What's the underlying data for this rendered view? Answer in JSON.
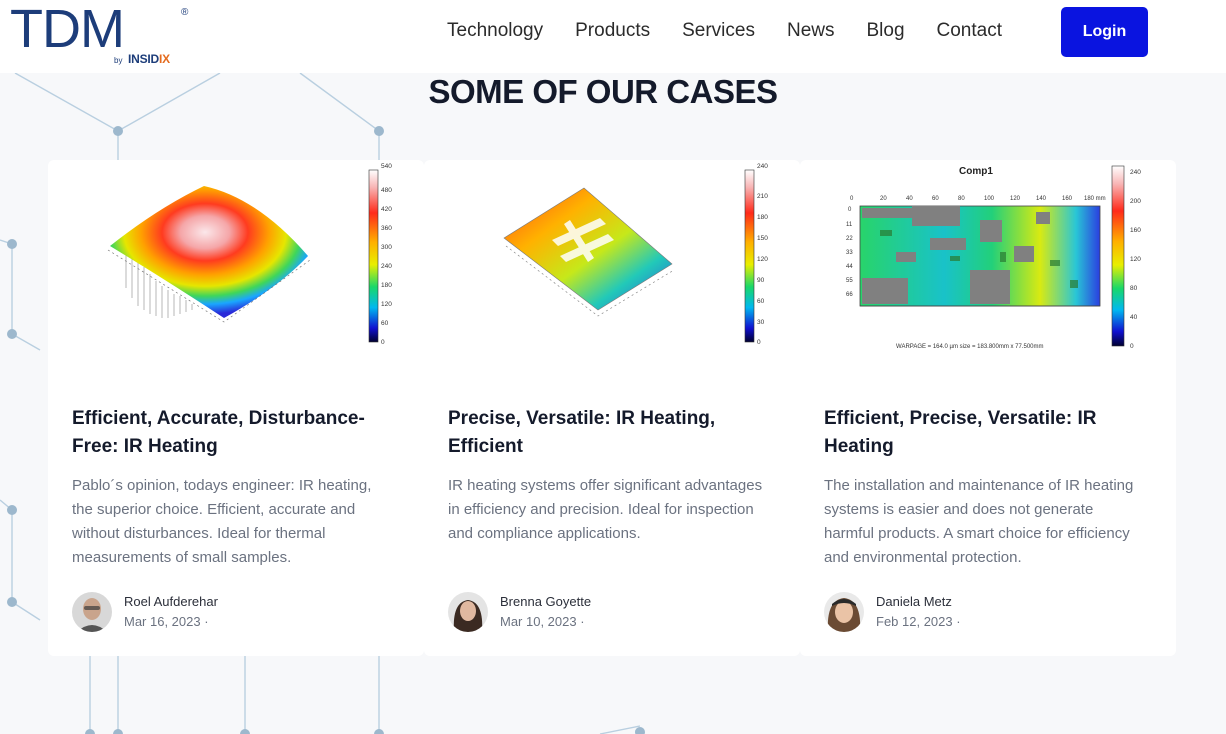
{
  "brand": {
    "logo_main": "TDM",
    "logo_reg": "®",
    "logo_by": "by",
    "logo_sub_a": "INSID",
    "logo_sub_b": "IX"
  },
  "nav": [
    "Technology",
    "Products",
    "Services",
    "News",
    "Blog",
    "Contact"
  ],
  "login_label": "Login",
  "section_title": "SOME OF OUR CASES",
  "cards": [
    {
      "title": "Efficient, Accurate, Disturbance-Free: IR Heating",
      "description": "Pablo´s opinion, todays engineer: IR heating, the superior choice. Efficient, accurate and without disturbances. Ideal for thermal measurements of small samples.",
      "author": "Roel Aufderehar",
      "date": "Mar 16, 2023 ·",
      "scale": [
        "540",
        "480",
        "420",
        "360",
        "300",
        "240",
        "180",
        "120",
        "60",
        "0"
      ]
    },
    {
      "title": "Precise, Versatile: IR Heating, Efficient",
      "description": "IR heating systems offer significant advantages in efficiency and precision. Ideal for inspection and compliance applications.",
      "author": "Brenna Goyette",
      "date": "Mar 10, 2023 ·",
      "scale": [
        "240",
        "210",
        "180",
        "150",
        "120",
        "90",
        "60",
        "30",
        "0"
      ]
    },
    {
      "title": "Efficient, Precise, Versatile: IR Heating",
      "description": "The installation and maintenance of IR heating systems is easier and does not generate harmful products. A smart choice for efficiency and environmental protection.",
      "author": "Daniela Metz",
      "date": "Feb 12, 2023 ·",
      "plot_title": "Comp1",
      "scale": [
        "240",
        "200",
        "160",
        "120",
        "80",
        "40",
        "0"
      ],
      "x_ticks": [
        "0",
        "20",
        "40",
        "60",
        "80",
        "100",
        "120",
        "140",
        "160",
        "180 mm"
      ],
      "y_ticks": [
        "0",
        "11",
        "22",
        "33",
        "44",
        "55",
        "66"
      ],
      "caption": "WARPAGE = 164.0 µm   size = 183.800mm x 77.500mm"
    }
  ],
  "colors": {
    "accent": "#0a14e0",
    "brand": "#1d3d7a",
    "brand_orange": "#e46b1e"
  }
}
